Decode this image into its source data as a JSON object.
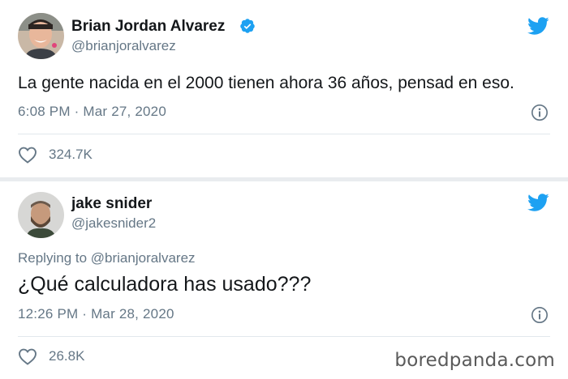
{
  "tweets": [
    {
      "name": "Brian Jordan Alvarez",
      "handle": "@brianjoralvarez",
      "verified": true,
      "text": "La gente nacida en el 2000 tienen ahora 36 años, pensad en eso.",
      "timestamp": "6:08 PM · Mar 27, 2020",
      "likes": "324.7K",
      "icons": [
        "avatar",
        "verified-badge-icon",
        "twitter-bird-icon",
        "info-icon",
        "heart-icon"
      ]
    },
    {
      "name": "jake snider",
      "handle": "@jakesnider2",
      "replying_to": "Replying to @brianjoralvarez",
      "text": "¿Qué calculadora has usado???",
      "timestamp": "12:26 PM · Mar 28, 2020",
      "likes": "26.8K",
      "icons": [
        "avatar",
        "twitter-bird-icon",
        "info-icon",
        "heart-icon"
      ]
    }
  ],
  "watermark": "boredpanda.com",
  "colors": {
    "twitter_blue": "#1da1f2",
    "muted_text": "#657786",
    "primary_text": "#14171a",
    "divider": "#e1e8ed"
  }
}
